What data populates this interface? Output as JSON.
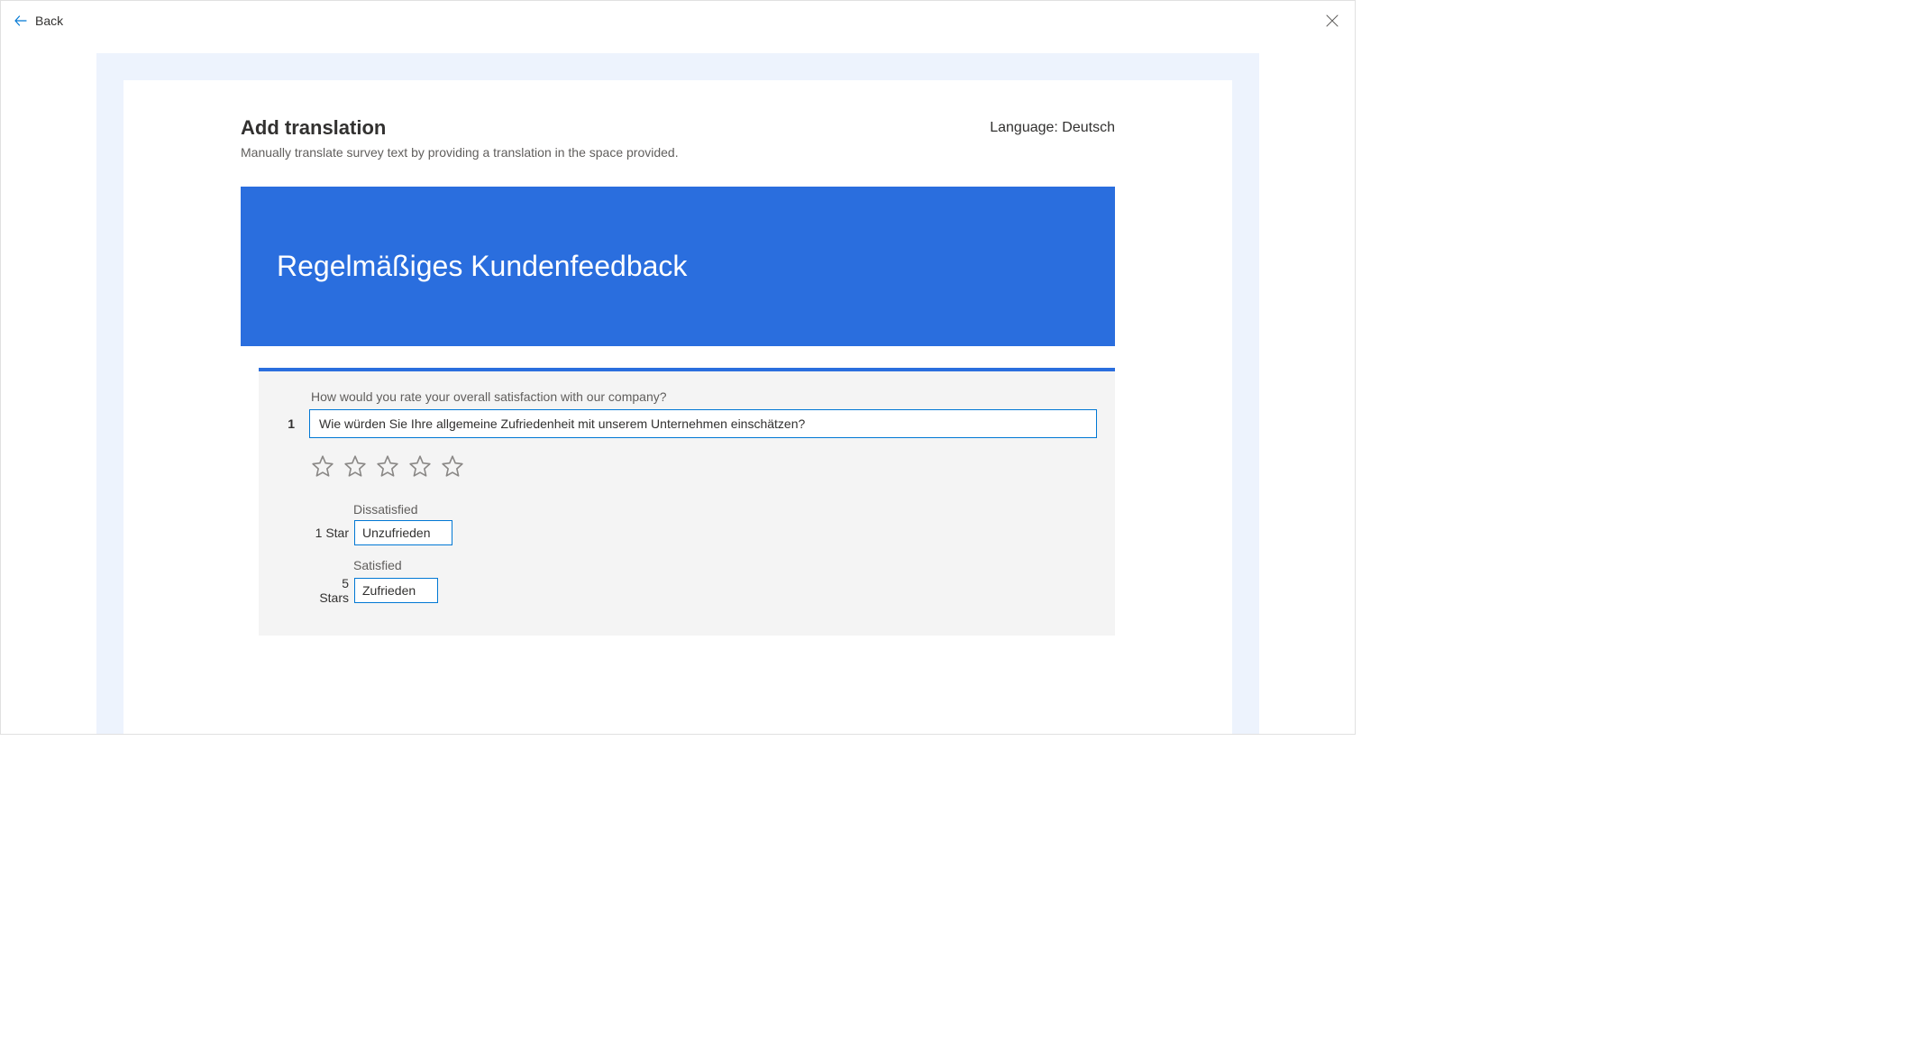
{
  "topbar": {
    "back_label": "Back"
  },
  "header": {
    "title": "Add translation",
    "subtitle": "Manually translate survey text by providing a translation in the space provided.",
    "language_prefix": "Language: ",
    "language_value": "Deutsch"
  },
  "banner": {
    "title": "Regelmäßiges Kundenfeedback"
  },
  "question": {
    "number": "1",
    "source_text": "How would you rate your overall satisfaction with our company?",
    "translation_value": "Wie würden Sie Ihre allgemeine Zufriedenheit mit unserem Unternehmen einschätzen?"
  },
  "rating_labels": {
    "low": {
      "source": "Dissatisfied",
      "anchor": "1 Star",
      "translation": "Unzufrieden"
    },
    "high": {
      "source": "Satisfied",
      "anchor": "5 Stars",
      "translation": "Zufrieden"
    }
  }
}
